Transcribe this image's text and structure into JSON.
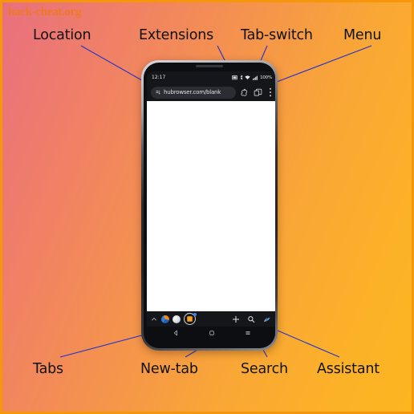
{
  "watermark": "hack-cheat.org",
  "background": {
    "gradient_from": "#e8707f",
    "gradient_mid": "#f4914f",
    "gradient_to": "#fdb520",
    "border_color": "#f6960a",
    "watermark_color": "#f07a1e"
  },
  "callouts": {
    "top": [
      {
        "label": "Location",
        "target": "url-bar"
      },
      {
        "label": "Extensions",
        "target": "extensions-icon"
      },
      {
        "label": "Tab-switch",
        "target": "tab-switch-icon"
      },
      {
        "label": "Menu",
        "target": "overflow-menu-icon"
      }
    ],
    "bottom": [
      {
        "label": "Tabs",
        "target": "tab-strip"
      },
      {
        "label": "New-tab",
        "target": "new-tab-button"
      },
      {
        "label": "Search",
        "target": "search-button"
      },
      {
        "label": "Assistant",
        "target": "assistant-button"
      }
    ],
    "leader_color": "#2233cc"
  },
  "phone": {
    "status_bar": {
      "time": "12:17",
      "battery_percent": "100%",
      "icons": [
        "screencast-icon",
        "bluetooth-icon",
        "wifi-icon",
        "signal-icon"
      ]
    },
    "browser": {
      "url": "hubrowser.com/blank",
      "url_leading_icon": "page-info-icon",
      "toolbar_icons": [
        "extensions-icon",
        "tab-switch-icon",
        "overflow-menu-icon"
      ],
      "page_background": "#ffffff"
    },
    "bottom_toolbar": {
      "expand_icon": "chevron-up-icon",
      "tabs": [
        {
          "name": "tab-1",
          "state": "inactive"
        },
        {
          "name": "tab-2",
          "state": "inactive"
        },
        {
          "name": "tab-3",
          "state": "active",
          "badge": true
        }
      ],
      "actions": [
        {
          "name": "new-tab-button",
          "icon": "plus-icon"
        },
        {
          "name": "search-button",
          "icon": "magnifier-icon"
        },
        {
          "name": "assistant-button",
          "icon": "assistant-bird-icon"
        }
      ]
    },
    "nav_bar": {
      "buttons": [
        {
          "name": "back-button",
          "icon": "triangle-left-icon"
        },
        {
          "name": "home-button",
          "icon": "square-icon"
        },
        {
          "name": "recents-button",
          "icon": "hamburger-icon"
        }
      ]
    }
  }
}
